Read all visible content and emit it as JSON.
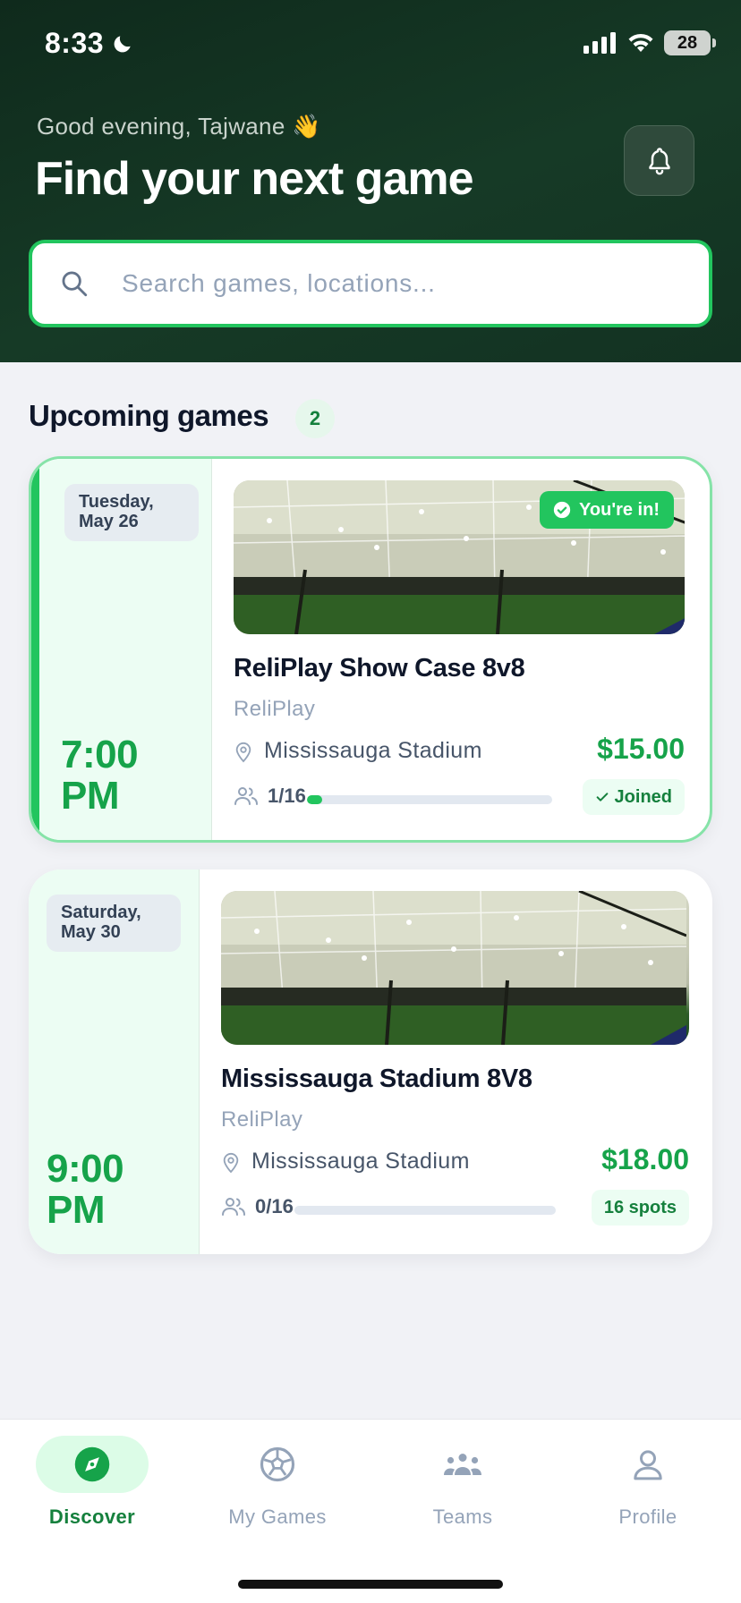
{
  "status_bar": {
    "time": "8:33",
    "battery": "28"
  },
  "header": {
    "greeting": "Good evening, Tajwane 👋",
    "headline": "Find your next game"
  },
  "search": {
    "placeholder": "Search games, locations..."
  },
  "section": {
    "title": "Upcoming games",
    "count": "2"
  },
  "games": [
    {
      "date_line1": "Tuesday,",
      "date_line2": "May 26",
      "time_line1": "7:00",
      "time_line2": "PM",
      "badge": "You're in!",
      "title": "ReliPlay Show Case 8v8",
      "organizer": "ReliPlay",
      "location": "Mississauga Stadium",
      "price": "$15.00",
      "players": "1/16",
      "fill_fraction": 0.0625,
      "status": "Joined"
    },
    {
      "date_line1": "Saturday,",
      "date_line2": "May 30",
      "time_line1": "9:00",
      "time_line2": "PM",
      "title": "Mississauga Stadium 8V8",
      "organizer": "ReliPlay",
      "location": "Mississauga Stadium",
      "price": "$18.00",
      "players": "0/16",
      "fill_fraction": 0,
      "status": "16 spots"
    }
  ],
  "nav": {
    "items": [
      {
        "label": "Discover",
        "icon": "compass-icon",
        "active": true
      },
      {
        "label": "My Games",
        "icon": "soccer-ball-icon",
        "active": false
      },
      {
        "label": "Teams",
        "icon": "team-icon",
        "active": false
      },
      {
        "label": "Profile",
        "icon": "profile-icon",
        "active": false
      }
    ]
  },
  "colors": {
    "accent": "#22c55e",
    "accent_dark": "#16a34a",
    "header_bg": "#133222"
  }
}
